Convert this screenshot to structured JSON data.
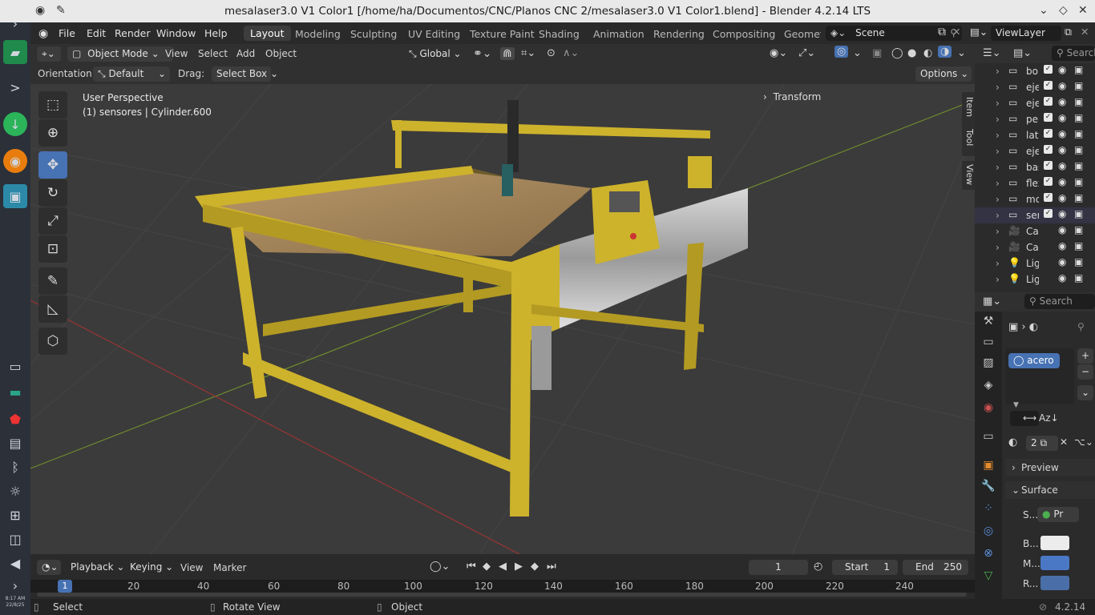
{
  "window": {
    "title": "mesalaser3.0 V1 Color1 [/home/ha/Documentos/CNC/Planos CNC 2/mesalaser3.0 V1 Color1.blend] - Blender 4.2.14 LTS"
  },
  "topbar": {
    "menus": [
      "File",
      "Edit",
      "Render",
      "Window",
      "Help"
    ],
    "workspaces": [
      "Layout",
      "Modeling",
      "Sculpting",
      "UV Editing",
      "Texture Paint",
      "Shading",
      "Animation",
      "Rendering",
      "Compositing",
      "Geometr"
    ],
    "scene": "Scene",
    "view_layer": "ViewLayer"
  },
  "viewport_header": {
    "mode": "Object Mode",
    "menus": [
      "View",
      "Select",
      "Add",
      "Object"
    ],
    "transform_orientation": "Global"
  },
  "tool_header": {
    "orientation_label": "Orientation:",
    "orientation_value": "Default",
    "drag_label": "Drag:",
    "drag_value": "Select Box",
    "options": "Options"
  },
  "viewport": {
    "perspective": "User Perspective",
    "active_object": "(1) sensores | Cylinder.600",
    "transform_panel": "Transform",
    "side_tabs": [
      "Item",
      "Tool",
      "View"
    ]
  },
  "outliner": {
    "search_placeholder": "Search",
    "items": [
      {
        "name": "bo",
        "type": "collection"
      },
      {
        "name": "eje",
        "type": "collection"
      },
      {
        "name": "eje",
        "type": "collection"
      },
      {
        "name": "per",
        "type": "collection"
      },
      {
        "name": "late",
        "type": "collection"
      },
      {
        "name": "eje",
        "type": "collection"
      },
      {
        "name": "bas",
        "type": "collection"
      },
      {
        "name": "flex",
        "type": "collection"
      },
      {
        "name": "mc",
        "type": "collection"
      },
      {
        "name": "ser",
        "type": "collection"
      },
      {
        "name": "Ca",
        "type": "camera"
      },
      {
        "name": "Ca",
        "type": "camera"
      },
      {
        "name": "Lig",
        "type": "light"
      },
      {
        "name": "Lig",
        "type": "light"
      }
    ]
  },
  "properties": {
    "search_placeholder": "Search",
    "material_slot": "acero",
    "material_users": "2",
    "panels": [
      "Preview",
      "Surface"
    ],
    "surface_rows": [
      {
        "label": "S...",
        "value": "Pr"
      },
      {
        "label": "B...",
        "value": ""
      },
      {
        "label": "M...",
        "value": ""
      },
      {
        "label": "R...",
        "value": ""
      }
    ],
    "colors": {
      "base": "#ececec",
      "metallic": "#4a78c4",
      "roughness": "#4a6fa8"
    }
  },
  "timeline": {
    "menus": [
      "Playback",
      "Keying",
      "View",
      "Marker"
    ],
    "current_frame": "1",
    "start_label": "Start",
    "start": "1",
    "end_label": "End",
    "end": "250",
    "ruler": [
      "1",
      "20",
      "40",
      "60",
      "80",
      "100",
      "120",
      "140",
      "160",
      "180",
      "200",
      "220",
      "240"
    ]
  },
  "statusbar": {
    "select": "Select",
    "rotate": "Rotate View",
    "object": "Object",
    "version": "4.2.14"
  },
  "dock": {
    "clock": "8:17 AM",
    "date": "22/8/25"
  },
  "theme": {
    "accent": "#4772b3",
    "model_yellow": "#cdb22c",
    "bed": "#a88a5a"
  }
}
